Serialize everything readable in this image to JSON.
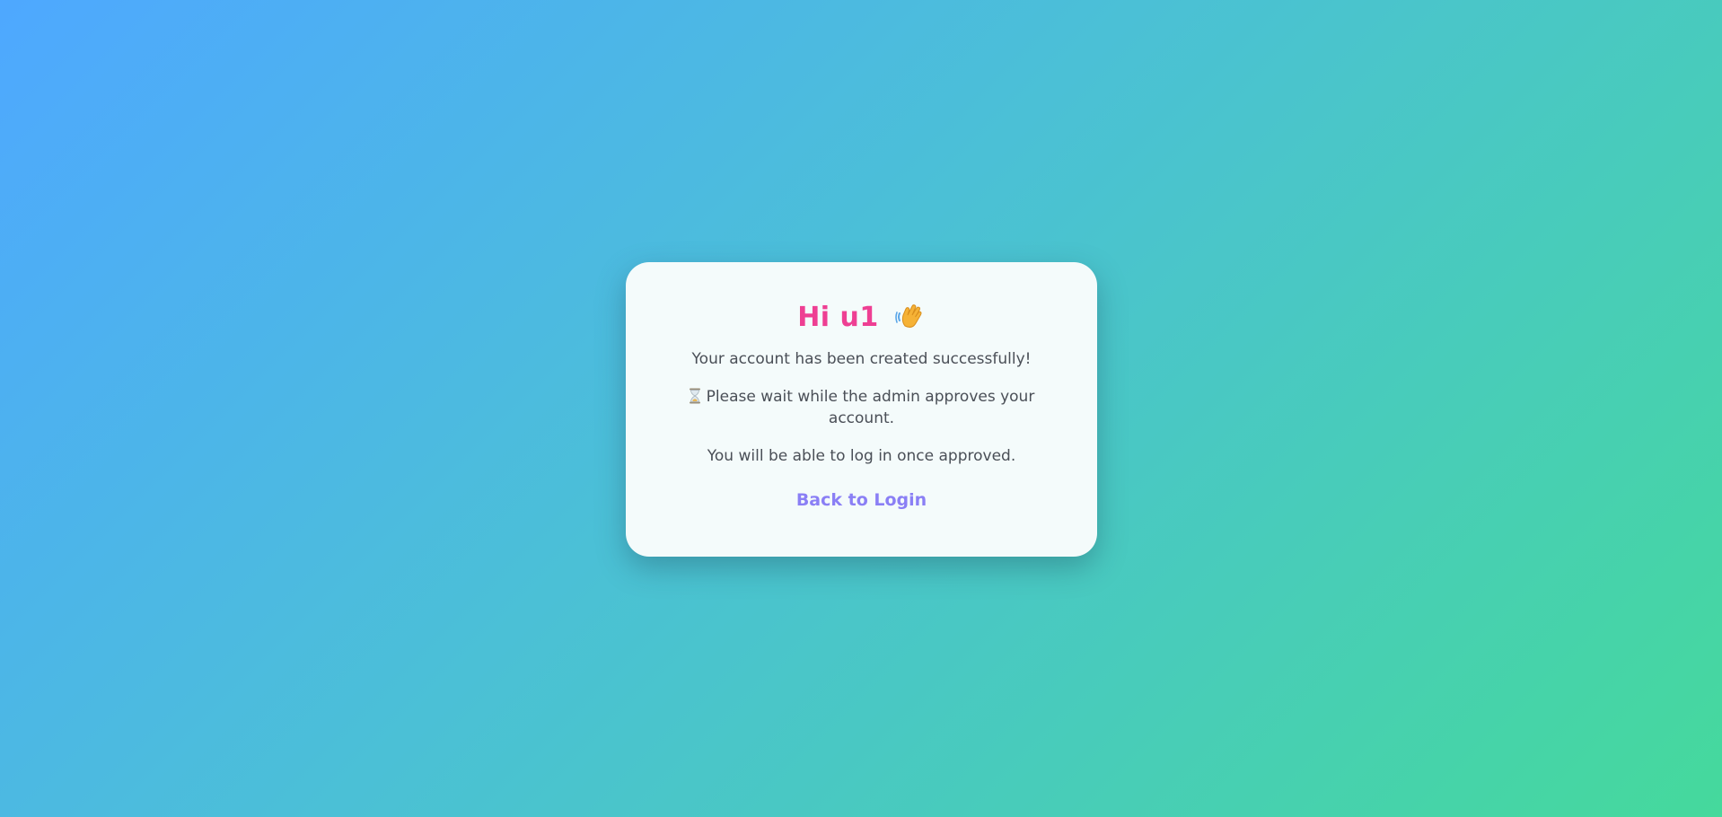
{
  "card": {
    "greeting": "Hi u1",
    "greeting_icon": "waving-hand-icon",
    "message_created": "Your account has been created successfully!",
    "message_wait_icon": "hourglass-icon",
    "message_wait": "Please wait while the admin approves your account.",
    "message_login": "You will be able to log in once approved.",
    "back_link_label": "Back to Login"
  },
  "colors": {
    "greeting": "#ee3f93",
    "link": "#8a7ff5",
    "card_background": "#f4fbfb",
    "gradient_start": "#4ea8ff",
    "gradient_end": "#45d99c"
  }
}
